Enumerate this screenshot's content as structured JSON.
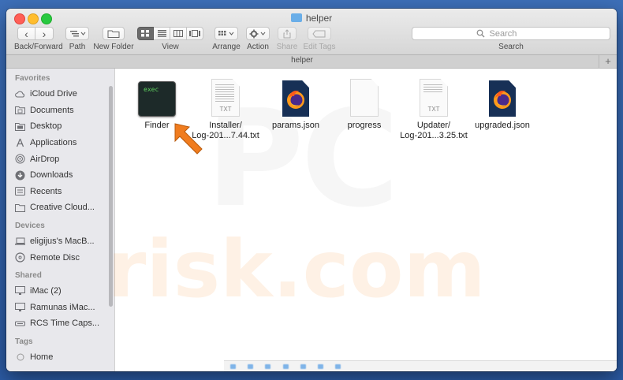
{
  "window": {
    "title": "helper",
    "tab_title": "helper",
    "tab_plus": "+"
  },
  "toolbar": {
    "back_forward_label": "Back/Forward",
    "path_label": "Path",
    "new_folder_label": "New Folder",
    "view_label": "View",
    "arrange_label": "Arrange",
    "action_label": "Action",
    "share_label": "Share",
    "edit_tags_label": "Edit Tags",
    "search_label": "Search",
    "search_placeholder": "Search",
    "back_glyph": "‹",
    "forward_glyph": "›"
  },
  "sidebar": {
    "sections": [
      {
        "header": "Favorites",
        "items": [
          {
            "label": "iCloud Drive",
            "icon": "cloud-icon"
          },
          {
            "label": "Documents",
            "icon": "documents-folder-icon"
          },
          {
            "label": "Desktop",
            "icon": "desktop-folder-icon"
          },
          {
            "label": "Applications",
            "icon": "applications-icon"
          },
          {
            "label": "AirDrop",
            "icon": "airdrop-icon"
          },
          {
            "label": "Downloads",
            "icon": "downloads-icon"
          },
          {
            "label": "Recents",
            "icon": "recents-icon"
          },
          {
            "label": "Creative Cloud...",
            "icon": "folder-icon"
          }
        ]
      },
      {
        "header": "Devices",
        "items": [
          {
            "label": "eligijus's MacB...",
            "icon": "laptop-icon"
          },
          {
            "label": "Remote Disc",
            "icon": "disc-icon"
          }
        ]
      },
      {
        "header": "Shared",
        "items": [
          {
            "label": "iMac (2)",
            "icon": "imac-icon"
          },
          {
            "label": "Ramunas iMac...",
            "icon": "imac-icon"
          },
          {
            "label": "RCS Time Caps...",
            "icon": "time-capsule-icon"
          }
        ]
      },
      {
        "header": "Tags",
        "items": [
          {
            "label": "Home",
            "icon": "tag-dot-icon"
          }
        ]
      }
    ]
  },
  "files": [
    {
      "name_line1": "Finder",
      "name_line2": "",
      "kind": "exec",
      "icon_text": "exec"
    },
    {
      "name_line1": "Installer/",
      "name_line2": "Log-201...7.44.txt",
      "kind": "txt",
      "icon_text": "TXT"
    },
    {
      "name_line1": "params.json",
      "name_line2": "",
      "kind": "firefox-json",
      "icon_text": ""
    },
    {
      "name_line1": "progress",
      "name_line2": "",
      "kind": "blank",
      "icon_text": ""
    },
    {
      "name_line1": "Updater/",
      "name_line2": "Log-201...3.25.txt",
      "kind": "txt",
      "icon_text": "TXT"
    },
    {
      "name_line1": "upgraded.json",
      "name_line2": "",
      "kind": "firefox-json",
      "icon_text": ""
    }
  ],
  "watermark": {
    "line1": "PC",
    "line2": "risk.com"
  },
  "colors": {
    "desktop": "#2b5aa3",
    "arrow": "#f07c1e",
    "sidebar_bg": "#e8e8ec",
    "active_segment": "#6b6b6b"
  }
}
